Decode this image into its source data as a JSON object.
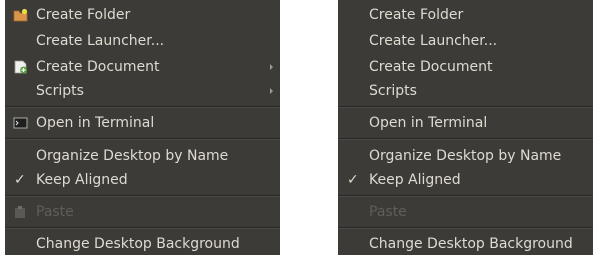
{
  "menus": [
    {
      "show_icons": true,
      "items": {
        "create_folder": "Create Folder",
        "create_launcher": "Create Launcher...",
        "create_document": "Create Document",
        "scripts": "Scripts",
        "open_terminal": "Open in Terminal",
        "organize_desktop": "Organize Desktop by Name",
        "keep_aligned": "Keep Aligned",
        "keep_aligned_check": "✓",
        "paste": "Paste",
        "change_background": "Change Desktop Background"
      }
    },
    {
      "show_icons": false,
      "items": {
        "create_folder": "Create Folder",
        "create_launcher": "Create Launcher...",
        "create_document": "Create Document",
        "scripts": "Scripts",
        "open_terminal": "Open in Terminal",
        "organize_desktop": "Organize Desktop by Name",
        "keep_aligned": "Keep Aligned",
        "keep_aligned_check": "✓",
        "paste": "Paste",
        "change_background": "Change Desktop Background"
      }
    }
  ],
  "colors": {
    "menu_background": "#3c3b37",
    "menu_text": "#dfdbd2",
    "disabled_text": "#5f5e5a"
  }
}
